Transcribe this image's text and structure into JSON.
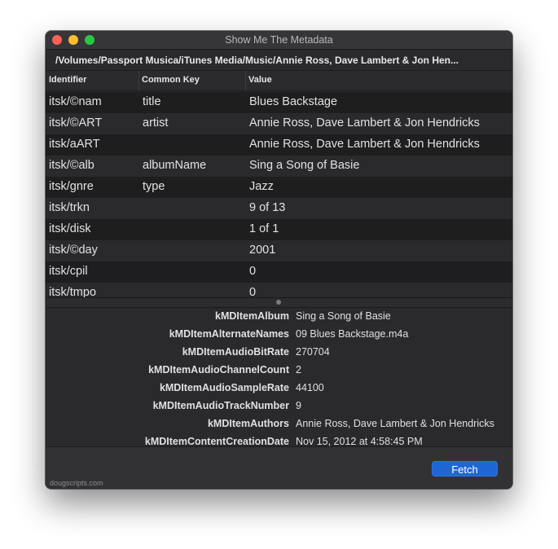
{
  "window": {
    "title": "Show Me The Metadata",
    "path": "/Volumes/Passport Musica/iTunes Media/Music/Annie Ross, Dave Lambert & Jon Hen..."
  },
  "table": {
    "headers": [
      "Identifier",
      "Common Key",
      "Value"
    ],
    "rows": [
      {
        "identifier": "itsk/©nam",
        "common_key": "title",
        "value": "Blues Backstage"
      },
      {
        "identifier": "itsk/©ART",
        "common_key": "artist",
        "value": "Annie Ross, Dave Lambert & Jon Hendricks"
      },
      {
        "identifier": "itsk/aART",
        "common_key": "",
        "value": "Annie Ross, Dave Lambert & Jon Hendricks"
      },
      {
        "identifier": "itsk/©alb",
        "common_key": "albumName",
        "value": "Sing a Song of Basie"
      },
      {
        "identifier": "itsk/gnre",
        "common_key": "type",
        "value": "Jazz"
      },
      {
        "identifier": "itsk/trkn",
        "common_key": "",
        "value": "9 of 13"
      },
      {
        "identifier": "itsk/disk",
        "common_key": "",
        "value": "1 of 1"
      },
      {
        "identifier": "itsk/©day",
        "common_key": "",
        "value": "2001"
      },
      {
        "identifier": "itsk/cpil",
        "common_key": "",
        "value": "0"
      },
      {
        "identifier": "itsk/tmpo",
        "common_key": "",
        "value": "0"
      }
    ]
  },
  "metadata": [
    {
      "key": "kMDItemAlbum",
      "value": "Sing a Song of Basie"
    },
    {
      "key": "kMDItemAlternateNames",
      "value": "09 Blues Backstage.m4a"
    },
    {
      "key": "kMDItemAudioBitRate",
      "value": "270704"
    },
    {
      "key": "kMDItemAudioChannelCount",
      "value": "2"
    },
    {
      "key": "kMDItemAudioSampleRate",
      "value": "44100"
    },
    {
      "key": "kMDItemAudioTrackNumber",
      "value": "9"
    },
    {
      "key": "kMDItemAuthors",
      "value": "Annie Ross, Dave Lambert & Jon Hendricks"
    },
    {
      "key": "kMDItemContentCreationDate",
      "value": "Nov 15, 2012 at 4:58:45 PM"
    }
  ],
  "footer": {
    "fetch_label": "Fetch",
    "credit": "dougscripts.com"
  }
}
